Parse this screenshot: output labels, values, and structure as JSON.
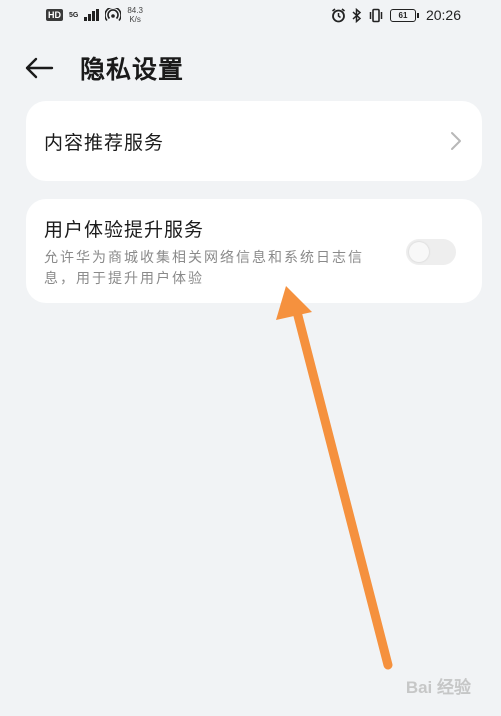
{
  "status_bar": {
    "hd": "HD",
    "network": "5G",
    "speed_value": "84.3",
    "speed_unit": "K/s",
    "battery": "61",
    "time": "20:26"
  },
  "header": {
    "title": "隐私设置"
  },
  "items": [
    {
      "label": "内容推荐服务"
    },
    {
      "label": "用户体验提升服务",
      "description": "允许华为商城收集相关网络信息和系统日志信息，用于提升用户体验",
      "toggle_on": false
    }
  ],
  "annotation": {
    "color": "#f5913e"
  },
  "watermark": {
    "text": "Bai 经验"
  },
  "icons": [
    "back-arrow-icon",
    "chevron-right-icon",
    "alarm-icon",
    "bluetooth-icon",
    "vibrate-icon",
    "hotspot-icon"
  ]
}
